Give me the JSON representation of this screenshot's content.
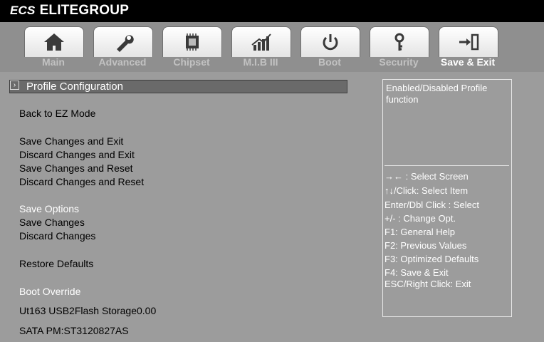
{
  "brand": {
    "logo": "ECS",
    "name": "ELITEGROUP"
  },
  "tabs": [
    {
      "label": "Main",
      "icon": "home-icon"
    },
    {
      "label": "Advanced",
      "icon": "wrench-icon"
    },
    {
      "label": "Chipset",
      "icon": "chip-icon"
    },
    {
      "label": "M.I.B III",
      "icon": "performance-chart-icon"
    },
    {
      "label": "Boot",
      "icon": "power-icon"
    },
    {
      "label": "Security",
      "icon": "key-icon"
    },
    {
      "label": "Save & Exit",
      "icon": "exit-icon"
    }
  ],
  "menu": {
    "selected": "Profile Configuration",
    "selected_marker": "›",
    "back": "Back to EZ Mode",
    "save_exit": "Save Changes and Exit",
    "discard_exit": "Discard Changes and Exit",
    "save_reset": "Save  Changes and Reset",
    "discard_reset": "Discard Changes and Reset",
    "save_options": "Save Options",
    "save_changes": "Save Changes",
    "discard_changes": "Discard Changes",
    "restore_defaults": "Restore Defaults",
    "boot_override": "Boot Override",
    "boot_device_1": "Ut163 USB2Flash Storage0.00",
    "boot_device_2": "SATA PM:ST3120827AS"
  },
  "help": {
    "description": "Enabled/Disabled Profile function",
    "keys": [
      "→←  : Select Screen",
      "↑↓/Click: Select Item",
      "Enter/Dbl Click : Select",
      "+/- : Change Opt.",
      "F1: General Help",
      "F2: Previous Values",
      "F3: Optimized Defaults",
      "F4: Save & Exit",
      "ESC/Right Click: Exit"
    ]
  }
}
